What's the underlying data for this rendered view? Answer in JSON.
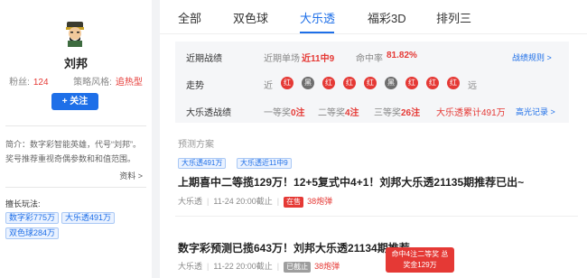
{
  "profile": {
    "name": "刘邦",
    "fans_label": "粉丝:",
    "fans_value": "124",
    "style_label": "策略风格:",
    "style_value": "追热型",
    "follow_label": "+ 关注",
    "intro": "简介：数字彩智能英雄，代号“刘邦”。奖号推荐重视奇偶参数和和值范围。",
    "more_label": "资料 >",
    "good_at_label": "擅长玩法:",
    "tags": [
      "数字彩775万",
      "大乐透491万",
      "双色球284万"
    ]
  },
  "tabs": [
    {
      "label": "全部"
    },
    {
      "label": "双色球"
    },
    {
      "label": "大乐透"
    },
    {
      "label": "福彩3D"
    },
    {
      "label": "排列三"
    }
  ],
  "stats": {
    "recent_label": "近期战绩",
    "single_label": "近期单场",
    "single_value": "近11中9",
    "rate_label": "命中率",
    "rate_value": "81.82%",
    "rules_link": "战绩规则 >",
    "trend_label": "走势",
    "near_label": "近",
    "far_label": "远",
    "balls": [
      {
        "text": "红",
        "color": "red"
      },
      {
        "text": "黑",
        "color": "black"
      },
      {
        "text": "红",
        "color": "red"
      },
      {
        "text": "红",
        "color": "red"
      },
      {
        "text": "红",
        "color": "red"
      },
      {
        "text": "黑",
        "color": "black"
      },
      {
        "text": "红",
        "color": "red"
      },
      {
        "text": "红",
        "color": "red"
      },
      {
        "text": "红",
        "color": "red"
      }
    ],
    "dlt_label": "大乐透战绩",
    "first_label": "一等奖",
    "first_value": "0注",
    "second_label": "二等奖",
    "second_value": "4注",
    "third_label": "三等奖",
    "third_value": "26注",
    "total_text": "大乐透累计491万",
    "history_link": "高光记录 >",
    "colors": {
      "red": "#e53935",
      "blue": "#1e6fe8"
    }
  },
  "plans": {
    "section_title": "预测方案",
    "items": [
      {
        "tags": [
          "大乐透491万",
          "大乐透近11中9"
        ],
        "title": "上期喜中二等揽129万！12+5复式中4+1！刘邦大乐透21135期推荐已出~",
        "lottery": "大乐透",
        "deadline": "11-24 20:00截止",
        "status": "在售",
        "price": "38炮弹"
      },
      {
        "title": "数字彩预测已揽643万！刘邦大乐透21134期推荐",
        "lottery": "大乐透",
        "deadline": "11-22 20:00截止",
        "status": "已截止",
        "price": "38炮弹",
        "win_line1": "命中4注二等奖 总",
        "win_line2": "奖金129万"
      }
    ]
  }
}
